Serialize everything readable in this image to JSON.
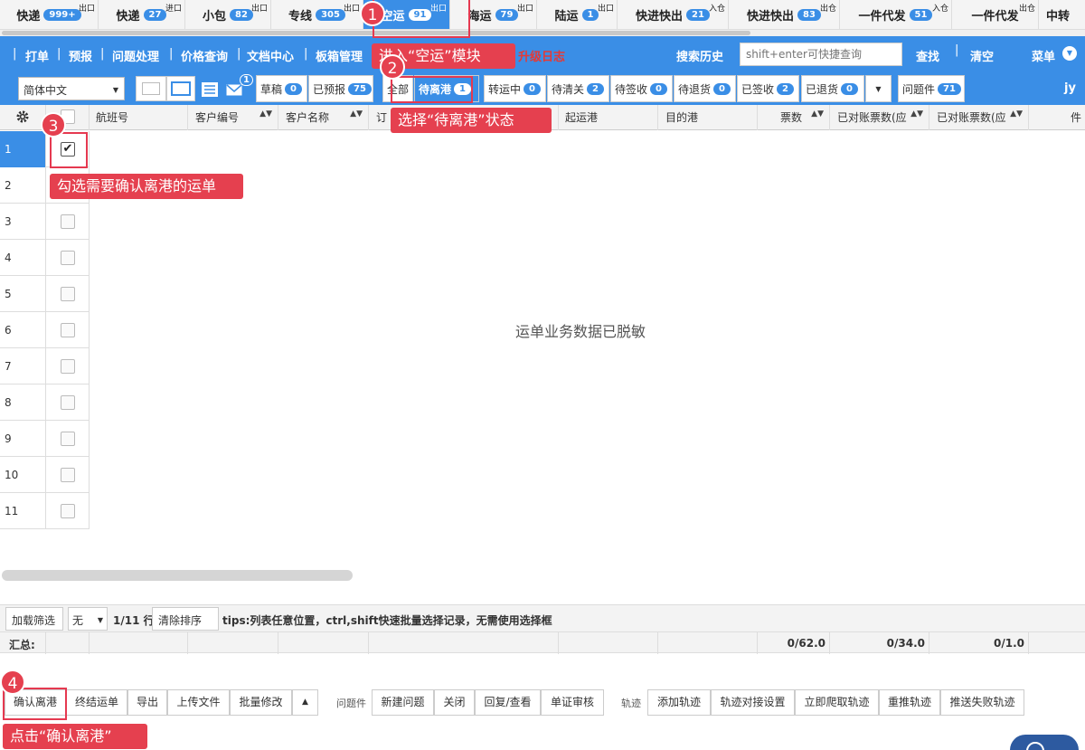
{
  "module_tabs": [
    {
      "label": "快递",
      "count": "999+",
      "sup": "出口"
    },
    {
      "label": "快递",
      "count": "27",
      "sup": "进口"
    },
    {
      "label": "小包",
      "count": "82",
      "sup": "出口"
    },
    {
      "label": "专线",
      "count": "305",
      "sup": "出口"
    },
    {
      "label": "空运",
      "count": "91",
      "sup": "出口"
    },
    {
      "label": "海运",
      "count": "79",
      "sup": "出口"
    },
    {
      "label": "陆运",
      "count": "1",
      "sup": "出口"
    },
    {
      "label": "快进快出",
      "count": "21",
      "sup": "入仓"
    },
    {
      "label": "快进快出",
      "count": "83",
      "sup": "出仓"
    },
    {
      "label": "一件代发",
      "count": "51",
      "sup": "入仓"
    },
    {
      "label": "一件代发",
      "count": "",
      "sup": "出仓"
    },
    {
      "label": "中转",
      "count": "",
      "sup": ""
    }
  ],
  "menubar": {
    "items": [
      "打单",
      "预报",
      "问题处理",
      "价格查询",
      "文档中心",
      "板箱管理"
    ],
    "upgrade_log": "升级日志",
    "search_history": "搜索历史",
    "search_placeholder": "shift+enter可快捷查询",
    "find": "查找",
    "clear": "清空",
    "menu": "菜单"
  },
  "toolbar": {
    "language": "简体中文",
    "mail_badge": "1",
    "status_buttons": [
      {
        "label": "草稿",
        "count": "0"
      },
      {
        "label": "已预报",
        "count": "75"
      },
      {
        "label": "全部",
        "count": ""
      },
      {
        "label": "待离港",
        "count": "1"
      },
      {
        "label": "转运中",
        "count": "0"
      },
      {
        "label": "待清关",
        "count": "2"
      },
      {
        "label": "待签收",
        "count": "0"
      },
      {
        "label": "待退货",
        "count": "0"
      },
      {
        "label": "已签收",
        "count": "2"
      },
      {
        "label": "已退货",
        "count": "0"
      }
    ],
    "issues": {
      "label": "问题件",
      "count": "71"
    },
    "user": "jy"
  },
  "columns": [
    "航班号",
    "客户编号",
    "客户名称",
    "订",
    "起运港",
    "目的港",
    "票数",
    "已对账票数(应",
    "已对账票数(应",
    "件"
  ],
  "rows": [
    "1",
    "2",
    "3",
    "4",
    "5",
    "6",
    "7",
    "8",
    "9",
    "10",
    "11"
  ],
  "selected_row": "1",
  "data_message": "运单业务数据已脱敏",
  "filter_bar": {
    "load_filter": "加载筛选",
    "filter_select": "无",
    "row_info": "1/11 行",
    "clear_sort": "清除排序",
    "tips_label": "tips:",
    "tips_text": "列表任意位置，ctrl,shift快速批量选择记录，无需使用选择框"
  },
  "summary": {
    "label": "汇总:",
    "tickets": "0/62.0",
    "recon1": "0/34.0",
    "recon2": "0/1.0"
  },
  "actions": {
    "main": [
      "确认离港",
      "终结运单",
      "导出",
      "上传文件",
      "批量修改"
    ],
    "issues_label": "问题件",
    "issues": [
      "新建问题",
      "关闭",
      "回复/查看",
      "单证审核"
    ],
    "track_label": "轨迹",
    "track": [
      "添加轨迹",
      "轨迹对接设置",
      "立即爬取轨迹",
      "重推轨迹",
      "推送失败轨迹"
    ]
  },
  "annotations": [
    {
      "num": "1",
      "text": "进入“空运”模块"
    },
    {
      "num": "2",
      "text": "选择“待离港”状态"
    },
    {
      "num": "3",
      "text": "勾选需要确认离港的运单"
    },
    {
      "num": "4",
      "text": "点击“确认离港”"
    }
  ],
  "colors": {
    "accent": "#3a8ee6",
    "annotation": "#e5404f"
  }
}
